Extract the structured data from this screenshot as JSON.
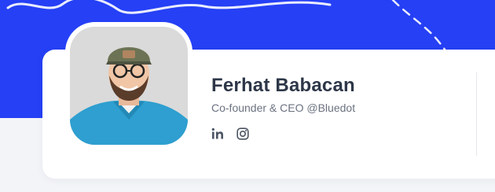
{
  "profile": {
    "name": "Ferhat Babacan",
    "role": "Co-founder & CEO @Bluedot"
  },
  "social_links": [
    {
      "icon": "linkedin-icon"
    },
    {
      "icon": "instagram-icon"
    }
  ],
  "colors": {
    "banner": "#2540f5",
    "card": "#ffffff",
    "page_background": "#f3f4f8",
    "name_text": "#2d3748",
    "role_text": "#6b7280"
  }
}
